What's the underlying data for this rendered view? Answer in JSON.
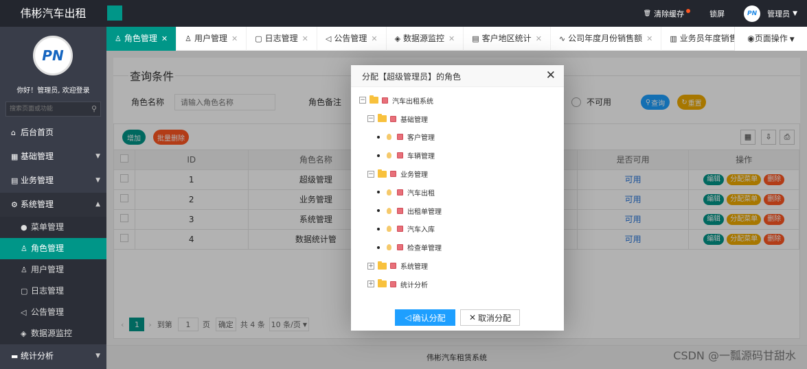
{
  "app": {
    "title": "伟彬汽车出租"
  },
  "header": {
    "clear_cache": "清除缓存",
    "lock": "锁屏",
    "user": "管理员"
  },
  "sidebar": {
    "logo_text": "PN",
    "welcome": "你好！管理员, 欢迎登录",
    "search_placeholder": "搜索页面或功能",
    "items": [
      {
        "label": "后台首页"
      },
      {
        "label": "基础管理"
      },
      {
        "label": "业务管理"
      },
      {
        "label": "系统管理"
      }
    ],
    "sub_items": [
      {
        "label": "菜单管理"
      },
      {
        "label": "角色管理"
      },
      {
        "label": "用户管理"
      },
      {
        "label": "日志管理"
      },
      {
        "label": "公告管理"
      },
      {
        "label": "数据源监控"
      }
    ],
    "last_item": {
      "label": "统计分析"
    }
  },
  "tabs": [
    {
      "label": "角色管理"
    },
    {
      "label": "用户管理"
    },
    {
      "label": "日志管理"
    },
    {
      "label": "公告管理"
    },
    {
      "label": "数据源监控"
    },
    {
      "label": "客户地区统计"
    },
    {
      "label": "公司年度月份销售额"
    },
    {
      "label": "业务员年度销售"
    }
  ],
  "page_ops": "页面操作",
  "query": {
    "legend": "查询条件",
    "role_name_label": "角色名称",
    "role_name_placeholder": "请输入角色名称",
    "role_remark_label": "角色备注",
    "unavailable_label": "不可用",
    "search_btn": "查询",
    "reset_btn": "重置"
  },
  "toolbar": {
    "add": "增加",
    "batch_delete": "批量删除"
  },
  "table": {
    "headers": [
      "ID",
      "角色名称",
      "是否可用",
      "操作"
    ],
    "rows": [
      {
        "id": "1",
        "name": "超级管理",
        "status": "可用"
      },
      {
        "id": "2",
        "name": "业务管理",
        "status": "可用"
      },
      {
        "id": "3",
        "name": "系统管理",
        "status": "可用"
      },
      {
        "id": "4",
        "name": "数据统计管",
        "status": "可用"
      }
    ],
    "actions": {
      "edit": "编辑",
      "assign": "分配菜单",
      "delete": "删除"
    }
  },
  "pager": {
    "current": "1",
    "goto": "到第",
    "page_value": "1",
    "page_unit": "页",
    "confirm": "确定",
    "total": "共 4 条",
    "size": "10 条/页"
  },
  "footer": "伟彬汽车租赁系统",
  "watermark": "CSDN @一瓢源码甘甜水",
  "modal": {
    "title": "分配【超级管理员】的角色",
    "root": "汽车出租系统",
    "groups": [
      {
        "label": "基础管理",
        "children": [
          "客户管理",
          "车辆管理"
        ]
      },
      {
        "label": "业务管理",
        "children": [
          "汽车出租",
          "出租单管理",
          "汽车入库",
          "检查单管理"
        ]
      }
    ],
    "collapsed": [
      "系统管理",
      "统计分析"
    ],
    "confirm": "确认分配",
    "cancel": "取消分配"
  },
  "colors": {
    "primary": "#009688",
    "header": "#23262e",
    "sidebar": "#393d49",
    "blue": "#1e9fff",
    "orange": "#f0ab00",
    "red": "#ff5722"
  }
}
